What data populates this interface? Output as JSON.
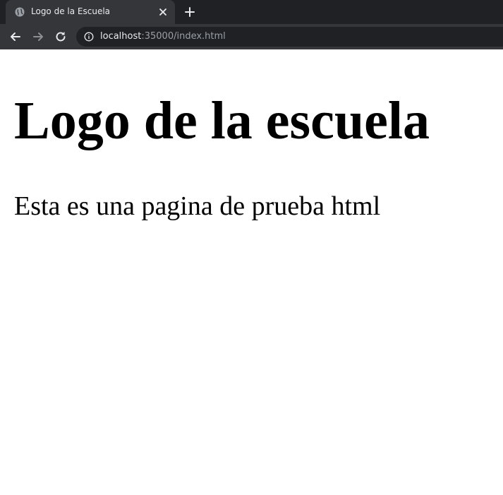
{
  "browser": {
    "tab": {
      "title": "Logo de la Escuela",
      "favicon": "globe-icon"
    },
    "toolbar": {
      "url_host": "localhost",
      "url_rest": ":35000/index.html"
    },
    "colors": {
      "tabstrip_bg": "#202124",
      "toolbar_bg": "#35363a",
      "omnibox_bg": "#202124",
      "text": "#e8eaed",
      "muted_text": "#9aa0a6"
    }
  },
  "page": {
    "heading": "Logo de la escuela",
    "paragraph": "Esta es una pagina de prueba html"
  }
}
